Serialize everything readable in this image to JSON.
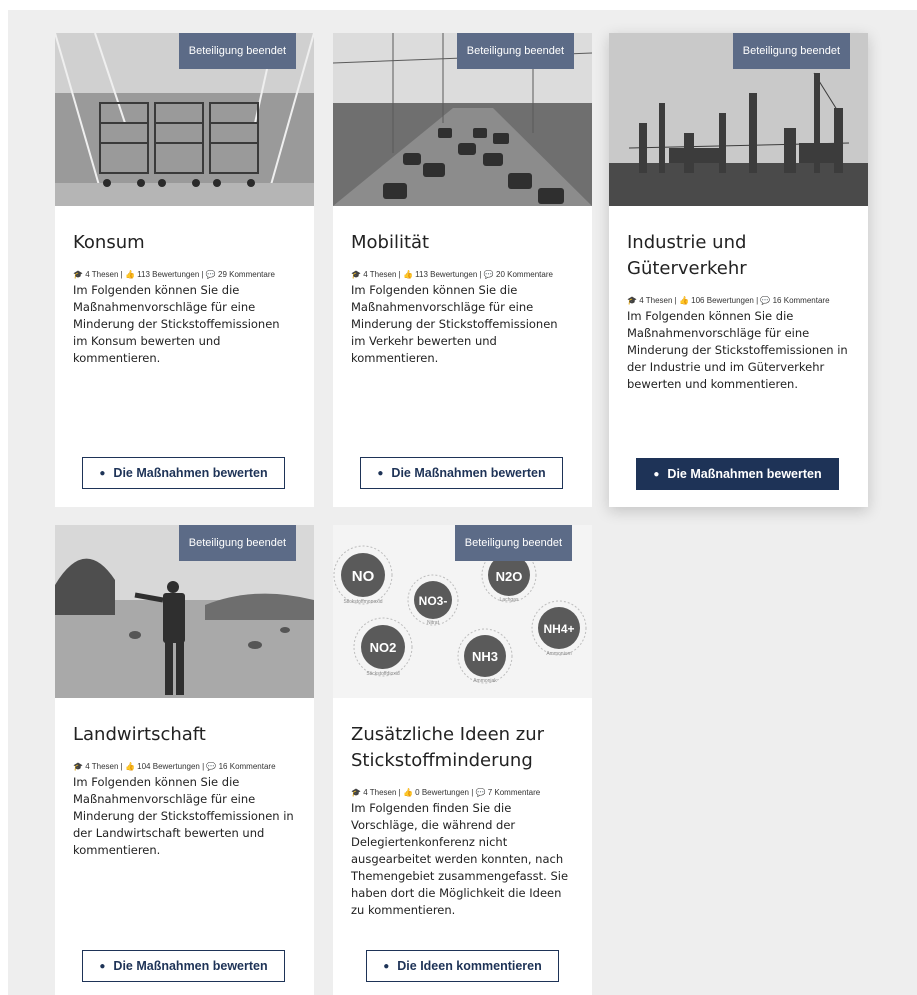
{
  "cards": [
    {
      "badge": "Beteiligung beendet",
      "title": "Konsum",
      "stats": {
        "thesen": "4 Thesen",
        "bewertungen": "113 Bewertungen",
        "kommentare": "29 Kommentare"
      },
      "description": "Im Folgenden können Sie die Maßnahmenvorschläge für eine Minderung der Stickstoffemissionen im Konsum bewerten und kommentieren.",
      "button": "Die Maßnahmen bewerten"
    },
    {
      "badge": "Beteiligung beendet",
      "title": "Mobilität",
      "stats": {
        "thesen": "4 Thesen",
        "bewertungen": "113 Bewertungen",
        "kommentare": "20 Kommentare"
      },
      "description": "Im Folgenden können Sie die Maßnahmenvorschläge für eine Minderung der Stickstoffemissionen im Verkehr bewerten und kommentieren.",
      "button": "Die Maßnahmen bewerten"
    },
    {
      "badge": "Beteiligung beendet",
      "title": "Industrie und Güterverkehr",
      "stats": {
        "thesen": "4 Thesen",
        "bewertungen": "106 Bewertungen",
        "kommentare": "16 Kommentare"
      },
      "description": "Im Folgenden können Sie die Maßnahmenvorschläge für eine Minderung der Stickstoffemissionen in der Industrie und im Güterverkehr bewerten und kommentieren.",
      "button": "Die Maßnahmen bewerten"
    },
    {
      "badge": "Beteiligung beendet",
      "title": "Landwirtschaft",
      "stats": {
        "thesen": "4 Thesen",
        "bewertungen": "104 Bewertungen",
        "kommentare": "16 Kommentare"
      },
      "description": "Im Folgenden können Sie die Maßnahmenvorschläge für eine Minderung der Stickstoffemissionen in der Landwirtschaft bewerten und kommentieren.",
      "button": "Die Maßnahmen bewerten"
    },
    {
      "badge": "Beteiligung beendet",
      "title": "Zusätzliche Ideen zur Stickstoffminderung",
      "stats": {
        "thesen": "4 Thesen",
        "bewertungen": "0 Bewertungen",
        "kommentare": "7 Kommentare"
      },
      "description": "Im Folgenden finden Sie die Vorschläge, die während der Delegiertenkonferenz nicht ausgearbeitet werden konnten, nach Themengebiet zusammengefasst. Sie haben dort die Möglichkeit die Ideen zu kommentieren.",
      "button": "Die Ideen kommentieren",
      "molecules": [
        {
          "label": "NO",
          "caption": "Stickstoffmonoxid"
        },
        {
          "label": "NO3-",
          "caption": "Nitrat"
        },
        {
          "label": "N2O",
          "caption": "Lachgas"
        },
        {
          "label": "NH4+",
          "caption": "Ammonium"
        },
        {
          "label": "NO2",
          "caption": "Stickstoffdioxid"
        },
        {
          "label": "NH3",
          "caption": "Ammoniak"
        }
      ]
    }
  ],
  "colors": {
    "badge": "#5c6b87",
    "button_border": "#1e3357",
    "page_bg": "#eeeeee"
  },
  "icons": {
    "thesen": "graduation-cap-icon",
    "bewertungen": "thumbs-up-icon",
    "kommentare": "comments-icon",
    "button": "comment-icon"
  }
}
